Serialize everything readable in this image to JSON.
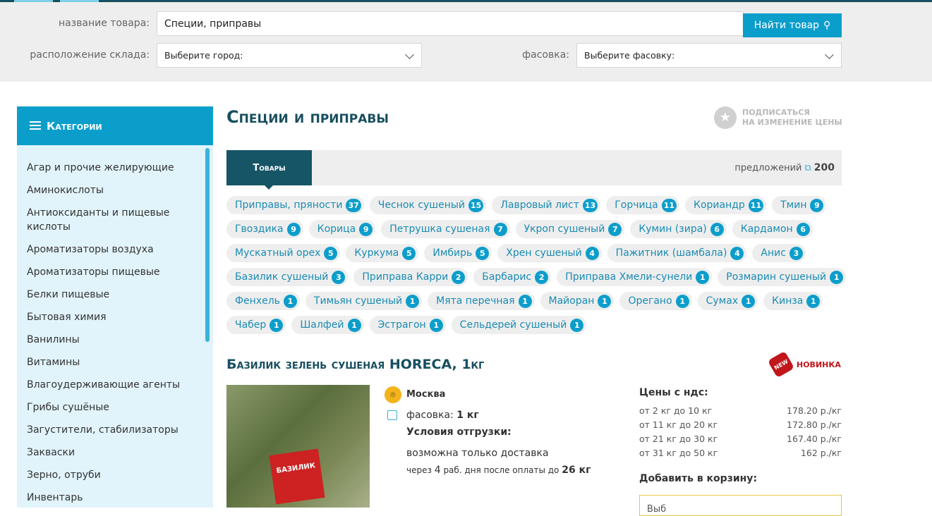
{
  "search": {
    "name_label": "название товара:",
    "name_value": "Специи, приправы",
    "find_button": "Найти товар",
    "warehouse_label": "расположение склада:",
    "warehouse_placeholder": "Выберите город:",
    "packing_label": "фасовка:",
    "packing_placeholder": "Выберите фасовку:"
  },
  "sidebar": {
    "title": "Категории",
    "items": [
      "Агар и прочие желирующие",
      "Аминокислоты",
      "Антиоксиданты и пищевые кислоты",
      "Ароматизаторы воздуха",
      "Ароматизаторы пищевые",
      "Белки пищевые",
      "Бытовая химия",
      "Ванилины",
      "Витамины",
      "Влагоудерживающие агенты",
      "Грибы сушёные",
      "Загустители, стабилизаторы",
      "Закваски",
      "Зерно, отруби",
      "Инвентарь"
    ]
  },
  "main": {
    "title": "Специи и приправы",
    "subscribe_line1": "ПОДПИСАТЬСЯ",
    "subscribe_line2": "НА ИЗМЕНЕНИЕ ЦЕНЫ",
    "tab": "Товары",
    "offers_label": "предложений",
    "offers_count": "200",
    "tags": [
      {
        "label": "Приправы, пряности",
        "count": "37"
      },
      {
        "label": "Чеснок сушеный",
        "count": "15"
      },
      {
        "label": "Лавровый лист",
        "count": "13"
      },
      {
        "label": "Горчица",
        "count": "11"
      },
      {
        "label": "Кориандр",
        "count": "11"
      },
      {
        "label": "Тмин",
        "count": "9"
      },
      {
        "label": "Гвоздика",
        "count": "9"
      },
      {
        "label": "Корица",
        "count": "9"
      },
      {
        "label": "Петрушка сушеная",
        "count": "7"
      },
      {
        "label": "Укроп сушеный",
        "count": "7"
      },
      {
        "label": "Кумин (зира)",
        "count": "6"
      },
      {
        "label": "Кардамон",
        "count": "6"
      },
      {
        "label": "Мускатный орех",
        "count": "5"
      },
      {
        "label": "Куркума",
        "count": "5"
      },
      {
        "label": "Имбирь",
        "count": "5"
      },
      {
        "label": "Хрен сушеный",
        "count": "4"
      },
      {
        "label": "Пажитник (шамбала)",
        "count": "4"
      },
      {
        "label": "Анис",
        "count": "3"
      },
      {
        "label": "Базилик сушеный",
        "count": "3"
      },
      {
        "label": "Приправа Карри",
        "count": "2"
      },
      {
        "label": "Барбарис",
        "count": "2"
      },
      {
        "label": "Приправа Хмели-сунели",
        "count": "1"
      },
      {
        "label": "Розмарин сушеный",
        "count": "1"
      },
      {
        "label": "Фенхель",
        "count": "1"
      },
      {
        "label": "Тимьян сушеный",
        "count": "1"
      },
      {
        "label": "Мята перечная",
        "count": "1"
      },
      {
        "label": "Майоран",
        "count": "1"
      },
      {
        "label": "Орегано",
        "count": "1"
      },
      {
        "label": "Сумах",
        "count": "1"
      },
      {
        "label": "Кинза",
        "count": "1"
      },
      {
        "label": "Чабер",
        "count": "1"
      },
      {
        "label": "Шалфей",
        "count": "1"
      },
      {
        "label": "Эстрагон",
        "count": "1"
      },
      {
        "label": "Сельдерей сушеный",
        "count": "1"
      }
    ]
  },
  "product": {
    "title": "Базилик зелень сушеная HORECA, 1кг",
    "new_badge": "НОВИНКА",
    "city": "Москва",
    "packing_label": "фасовка:",
    "packing_value": "1 кг",
    "shipping_title": "Условия отгрузки:",
    "shipping_text": "возможна только доставка",
    "delivery_prefix": "через",
    "delivery_days": "4",
    "delivery_mid": "раб. дня после оплаты до",
    "delivery_weight": "26 кг",
    "prices_title": "Цены с ндс:",
    "prices": [
      {
        "range": "от 2 кг до 10 кг",
        "price": "178.20 р./кг"
      },
      {
        "range": "от 11 кг до 20 кг",
        "price": "172.80 р./кг"
      },
      {
        "range": "от 21 кг до 30 кг",
        "price": "167.40 р./кг"
      },
      {
        "range": "от 31 кг до 50 кг",
        "price": "162 р./кг"
      }
    ],
    "cart_title": "Добавить в корзину:",
    "cart_select": "Выб",
    "image_label": "БАЗИЛИК"
  }
}
